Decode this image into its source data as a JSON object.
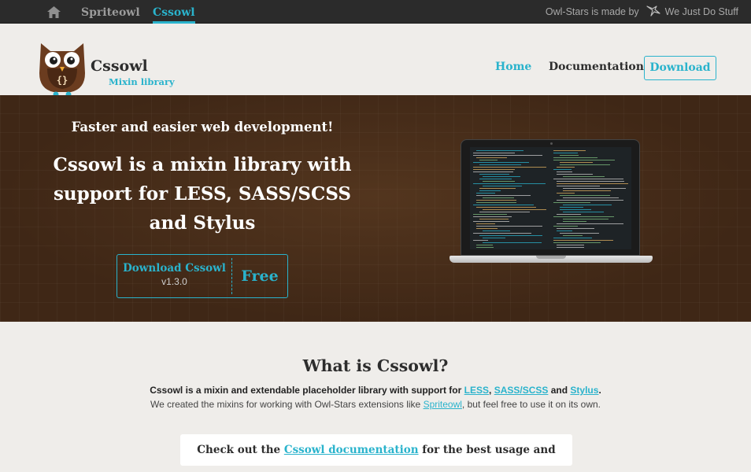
{
  "topbar": {
    "nav": [
      {
        "label": "Spriteowl",
        "active": false
      },
      {
        "label": "Cssowl",
        "active": true
      }
    ],
    "madeby_prefix": "Owl-Stars is made by",
    "madeby_company": "We Just Do Stuff"
  },
  "header": {
    "logo_name": "Cssowl",
    "logo_subtitle": "Mixin library",
    "nav": {
      "home": "Home",
      "docs": "Documentation",
      "download": "Download"
    }
  },
  "hero": {
    "tagline": "Faster and easier web development!",
    "headline": "Cssowl is a mixin library with support for LESS, SASS/SCSS and Stylus",
    "cta_label": "Download Cssowl",
    "cta_version": "v1.3.0",
    "cta_price": "Free"
  },
  "what": {
    "title": "What is Cssowl?",
    "line1_prefix": "Cssowl is a mixin and extendable placeholder library with support for",
    "line1_links": [
      "LESS",
      "SASS/SCSS",
      "Stylus"
    ],
    "line1_sep1": ",",
    "line1_and": "and",
    "line1_end": ".",
    "line2_prefix": "We created the mixins for working with Owl-Stars extensions like",
    "line2_link": "Spriteowl",
    "line2_suffix": ", but feel free to use it on its own."
  },
  "docbox": {
    "prefix": "Check out the",
    "link": "Cssowl documentation",
    "suffix": "for the best usage and examples."
  },
  "colors": {
    "accent": "#2ab3cc",
    "topbar_bg": "#2b2b2b",
    "hero_bg": "#3f2716",
    "page_bg": "#efedea"
  },
  "icons": {
    "home": "home-icon",
    "company": "bird-logo-icon",
    "logo": "owl-logo-icon"
  }
}
